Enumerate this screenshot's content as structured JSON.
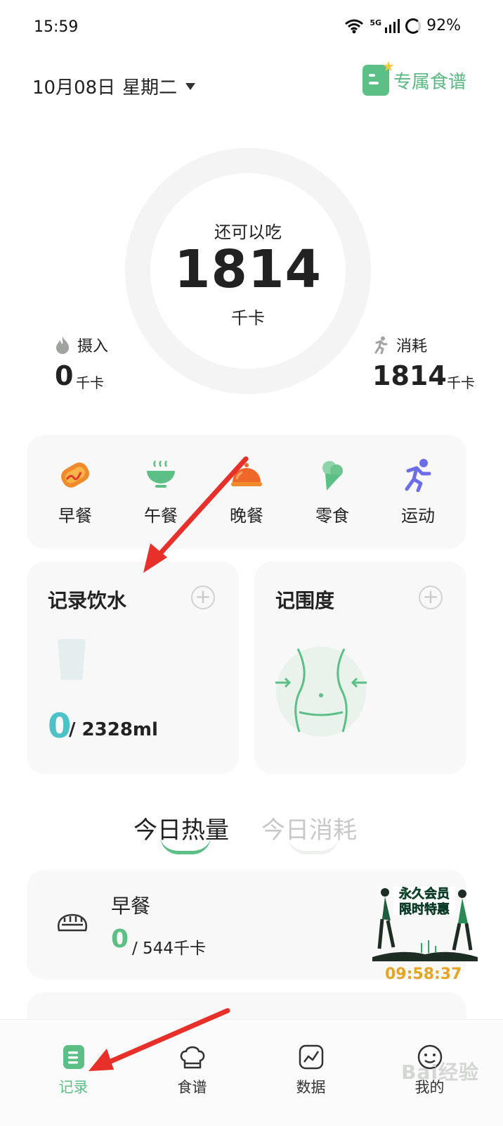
{
  "status_bar": {
    "time": "15:59",
    "network": "5G",
    "battery": "92%"
  },
  "header": {
    "date": "10月08日",
    "weekday": "星期二",
    "recipe_link": "专属食谱"
  },
  "calorie_ring": {
    "label": "还可以吃",
    "value": "1814",
    "unit": "千卡"
  },
  "intake": {
    "label": "摄入",
    "value": "0",
    "unit": "千卡"
  },
  "burn": {
    "label": "消耗",
    "value": "1814",
    "unit": "千卡"
  },
  "meals": [
    {
      "label": "早餐",
      "icon": "hotdog-icon"
    },
    {
      "label": "午餐",
      "icon": "bowl-icon"
    },
    {
      "label": "晚餐",
      "icon": "cloche-icon"
    },
    {
      "label": "零食",
      "icon": "ice-cream-icon"
    },
    {
      "label": "运动",
      "icon": "runner-icon"
    }
  ],
  "water": {
    "title": "记录饮水",
    "value": "0",
    "target": "/ 2328ml"
  },
  "girth": {
    "title": "记围度"
  },
  "tabs": {
    "active": "今日热量",
    "inactive": "今日消耗"
  },
  "breakfast": {
    "title": "早餐",
    "value": "0",
    "target": "/ 544千卡"
  },
  "promo": {
    "line1": "永久会员",
    "line2": "限时特惠",
    "timer": "09:58:37"
  },
  "bottom_nav": [
    {
      "label": "记录",
      "icon": "record-icon",
      "active": true
    },
    {
      "label": "食谱",
      "icon": "chef-hat-icon",
      "active": false
    },
    {
      "label": "数据",
      "icon": "chart-icon",
      "active": false
    },
    {
      "label": "我的",
      "icon": "smiley-icon",
      "active": false
    }
  ],
  "watermark": "Bai经验",
  "colors": {
    "accent": "#5cbf86",
    "water": "#4cc1c8",
    "timer": "#e5a524",
    "arrow": "#e8302a"
  }
}
